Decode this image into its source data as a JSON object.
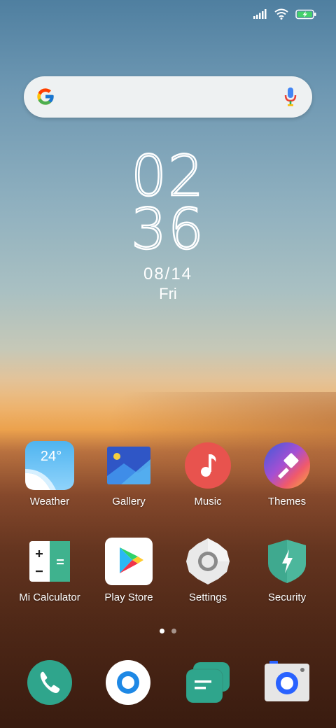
{
  "status_bar": {
    "signal_icon": "signal-bars-icon",
    "wifi_icon": "wifi-icon",
    "battery_icon": "battery-charging-icon"
  },
  "search": {
    "placeholder": "",
    "logo_icon": "google-g-icon",
    "mic_icon": "microphone-icon"
  },
  "clock": {
    "hours": "02",
    "minutes": "36",
    "date": "08/14",
    "day": "Fri"
  },
  "apps": [
    {
      "label": "Weather",
      "icon": "weather-icon",
      "temp": "24°"
    },
    {
      "label": "Gallery",
      "icon": "gallery-icon"
    },
    {
      "label": "Music",
      "icon": "music-icon"
    },
    {
      "label": "Themes",
      "icon": "themes-icon"
    },
    {
      "label": "Mi Calculator",
      "icon": "calculator-icon"
    },
    {
      "label": "Play Store",
      "icon": "play-store-icon"
    },
    {
      "label": "Settings",
      "icon": "settings-gear-icon"
    },
    {
      "label": "Security",
      "icon": "security-shield-icon"
    }
  ],
  "page_indicator": {
    "pages": 2,
    "current": 1
  },
  "dock": [
    {
      "icon": "phone-icon"
    },
    {
      "icon": "browser-icon"
    },
    {
      "icon": "messages-icon"
    },
    {
      "icon": "camera-icon"
    }
  ],
  "colors": {
    "phone": "#2fa58c",
    "messages": "#2fa58c",
    "music": "#e8534e",
    "security": "#3fa98f"
  }
}
